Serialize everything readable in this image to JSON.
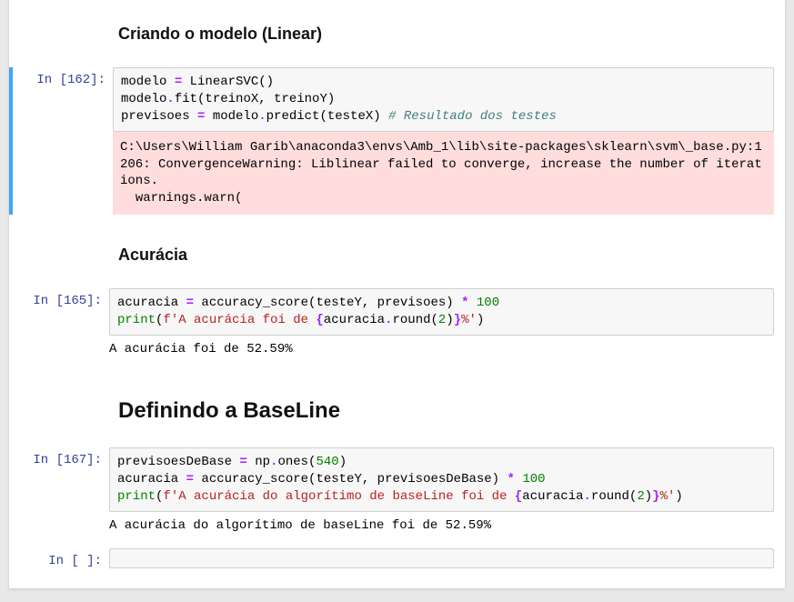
{
  "cells": {
    "md1": {
      "heading": "Criando o modelo (Linear)"
    },
    "code1": {
      "prompt_label": "In [162]:",
      "line1_a": "modelo ",
      "line1_b": "=",
      "line1_c": " LinearSVC()",
      "line2_a": "modelo",
      "line2_b": ".",
      "line2_c": "fit(treinoX, treinoY)",
      "line3_a": "previsoes ",
      "line3_b": "=",
      "line3_c": " modelo",
      "line3_d": ".",
      "line3_e": "predict(testeX) ",
      "line3_comment": "# Resultado dos testes",
      "stderr": "C:\\Users\\William Garib\\anaconda3\\envs\\Amb_1\\lib\\site-packages\\sklearn\\svm\\_base.py:1206: ConvergenceWarning: Liblinear failed to converge, increase the number of iterations.\n  warnings.warn("
    },
    "md2": {
      "heading": "Acurácia"
    },
    "code2": {
      "prompt_label": "In [165]:",
      "line1_a": "acuracia ",
      "line1_b": "=",
      "line1_c": " accuracy_score(testeY, previsoes) ",
      "line1_d": "*",
      "line1_e": " ",
      "line1_num": "100",
      "line2_a": "print",
      "line2_b": "(",
      "line2_str_a": "f'A acurácia foi de ",
      "line2_fmt_a": "{",
      "line2_fmt_b": "acuracia",
      "line2_fmt_c": ".",
      "line2_fmt_d": "round(",
      "line2_fmt_num": "2",
      "line2_fmt_e": ")",
      "line2_fmt_f": "}",
      "line2_str_b": "%'",
      "line2_c": ")",
      "stdout": "A acurácia foi de 52.59%"
    },
    "md3": {
      "heading": "Definindo a BaseLine"
    },
    "code3": {
      "prompt_label": "In [167]:",
      "line1_a": "previsoesDeBase ",
      "line1_b": "=",
      "line1_c": " np",
      "line1_d": ".",
      "line1_e": "ones(",
      "line1_num": "540",
      "line1_f": ")",
      "line2_a": "acuracia ",
      "line2_b": "=",
      "line2_c": " accuracy_score(testeY, previsoesDeBase) ",
      "line2_d": "*",
      "line2_e": " ",
      "line2_num": "100",
      "line3_a": "print",
      "line3_b": "(",
      "line3_str_a": "f'A acurácia do algorítimo de baseLine foi de ",
      "line3_fmt_a": "{",
      "line3_fmt_b": "acuracia",
      "line3_fmt_c": ".",
      "line3_fmt_d": "round(",
      "line3_fmt_num": "2",
      "line3_fmt_e": ")",
      "line3_fmt_f": "}",
      "line3_str_b": "%'",
      "line3_c": ")",
      "stdout": "A acurácia do algorítimo de baseLine foi de 52.59%"
    },
    "code4": {
      "prompt_label": "In [ ]:"
    }
  }
}
